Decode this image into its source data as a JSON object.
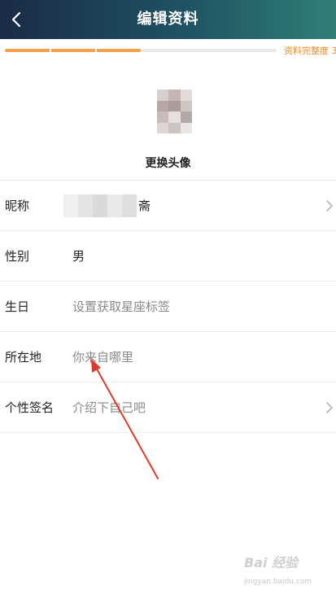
{
  "header": {
    "title": "编辑资料",
    "back_icon": "chevron-left-icon"
  },
  "progress": {
    "label": "资料完整度 3",
    "fraction": 0.5,
    "fill_color": "#f5a04a"
  },
  "avatar": {
    "change_label": "更换头像"
  },
  "rows": [
    {
      "label": "昵称",
      "value": "斋",
      "has_chevron": true
    },
    {
      "label": "性别",
      "value": "男",
      "has_chevron": false
    },
    {
      "label": "生日",
      "value": "设置获取星座标签",
      "placeholder": true,
      "has_chevron": false
    },
    {
      "label": "所在地",
      "value": "你来自哪里",
      "placeholder": true,
      "has_chevron": false
    },
    {
      "label": "个性签名",
      "value": "介绍下自己吧",
      "placeholder": true,
      "has_chevron": true
    }
  ],
  "watermark": {
    "brand": "Bai 经验",
    "url": "jingyan.baidu.com"
  },
  "colors": {
    "header_start": "#1a2b45",
    "header_end": "#2f7f78",
    "accent_orange": "#f08a24",
    "annotation_arrow": "#e03a2a"
  }
}
